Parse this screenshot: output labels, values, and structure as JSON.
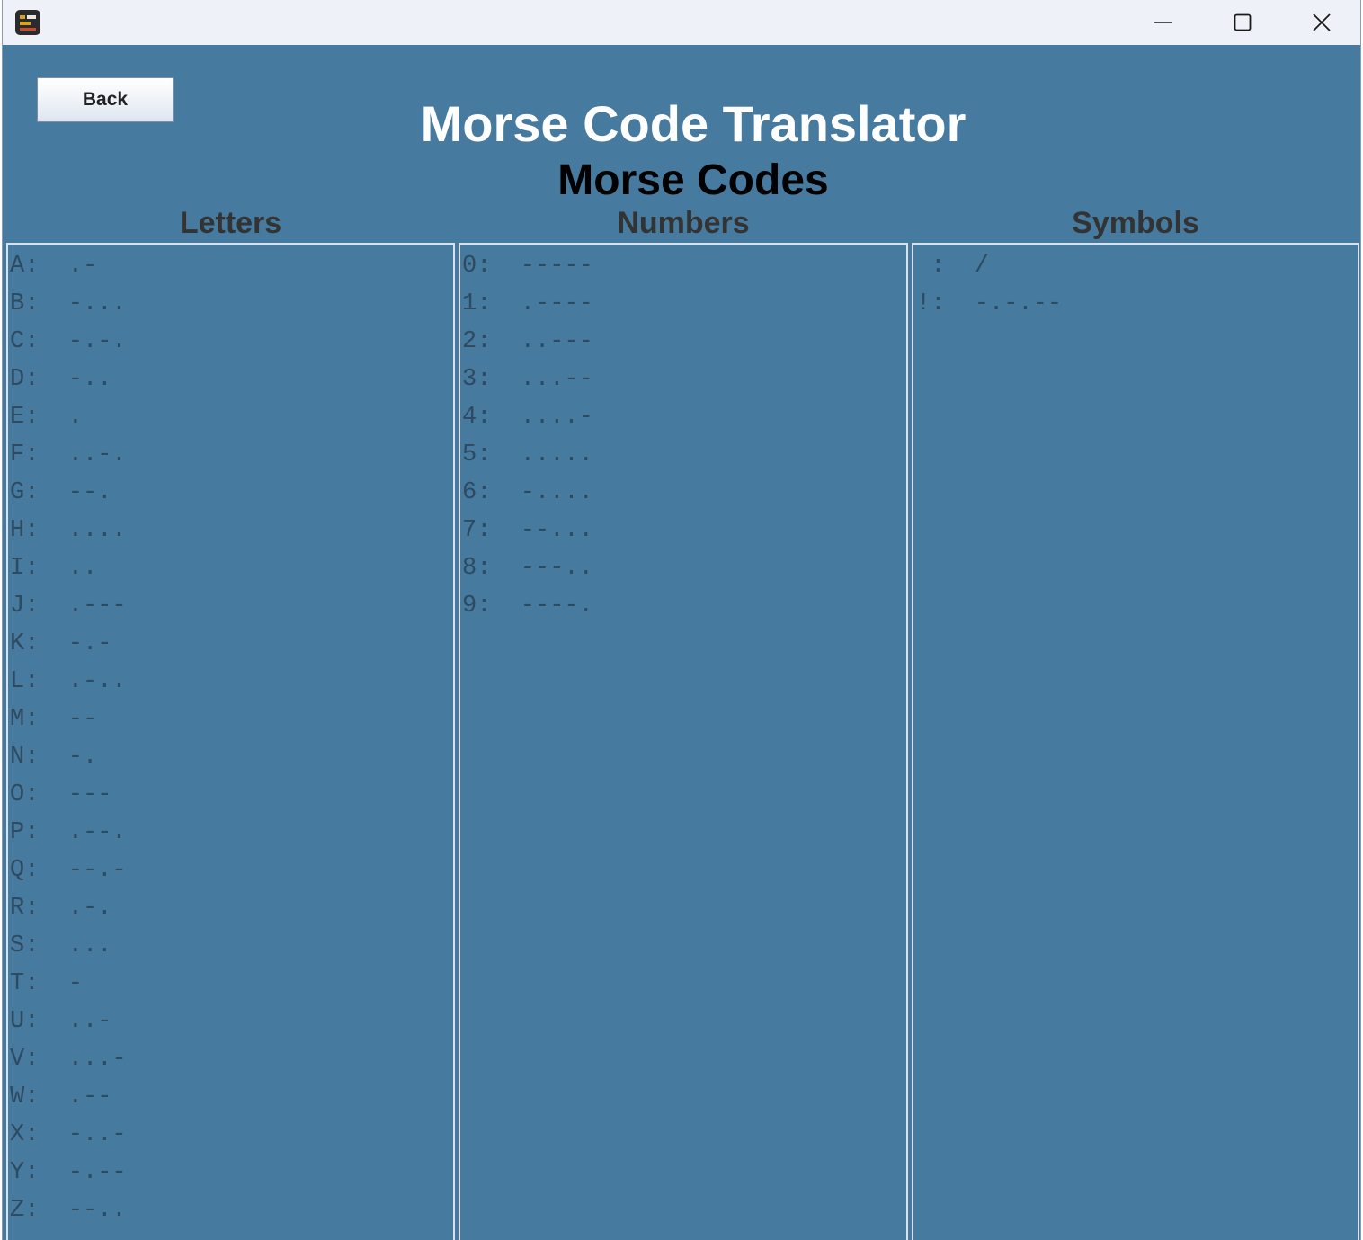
{
  "window": {
    "controls": {
      "minimize": "minimize-icon",
      "maximize": "maximize-icon",
      "close": "close-icon"
    }
  },
  "toolbar": {
    "back_label": "Back"
  },
  "header": {
    "title": "Morse Code Translator",
    "subtitle": "Morse Codes"
  },
  "columns": {
    "letters": {
      "heading": "Letters",
      "items": [
        "A:  .-",
        "B:  -...",
        "C:  -.-.",
        "D:  -..",
        "E:  .",
        "F:  ..-.",
        "G:  --.",
        "H:  ....",
        "I:  ..",
        "J:  .---",
        "K:  -.-",
        "L:  .-..",
        "M:  --",
        "N:  -.",
        "O:  ---",
        "P:  .--.",
        "Q:  --.-",
        "R:  .-.",
        "S:  ...",
        "T:  -",
        "U:  ..-",
        "V:  ...-",
        "W:  .--",
        "X:  -..-",
        "Y:  -.--",
        "Z:  --.."
      ]
    },
    "numbers": {
      "heading": "Numbers",
      "items": [
        "0:  -----",
        "1:  .----",
        "2:  ..---",
        "3:  ...--",
        "4:  ....-",
        "5:  .....",
        "6:  -....",
        "7:  --...",
        "8:  ---..",
        "9:  ----."
      ]
    },
    "symbols": {
      "heading": "Symbols",
      "items": [
        " :  /",
        "!:  -.-.--"
      ]
    }
  },
  "colors": {
    "background": "#467a9e",
    "title": "#ffffff",
    "subtitle": "#000000",
    "column_heading": "#333333",
    "code_text": "#2e4a61",
    "panel_border": "#d9e1ea"
  }
}
